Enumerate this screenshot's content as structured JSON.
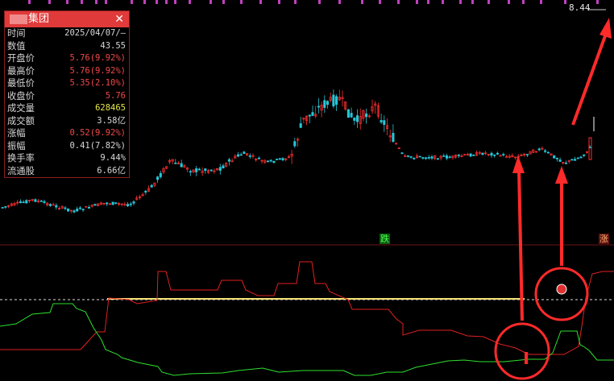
{
  "panel": {
    "title": "集团",
    "close_icon": "close-icon",
    "rows": [
      {
        "label": "时间",
        "value": "2025/04/07/—",
        "color": "#d7d7d7"
      },
      {
        "label": "数值",
        "value": "43.55",
        "color": "#d7d7d7"
      },
      {
        "label": "开盘价",
        "value": "5.76(9.92%)",
        "color": "#f04848"
      },
      {
        "label": "最高价",
        "value": "5.76(9.92%)",
        "color": "#f04848"
      },
      {
        "label": "最低价",
        "value": "5.35(2.10%)",
        "color": "#f04848"
      },
      {
        "label": "收盘价",
        "value": "5.76",
        "color": "#f04848"
      },
      {
        "label": "成交量",
        "value": "628465",
        "color": "#e6e64a"
      },
      {
        "label": "成交额",
        "value": "3.58亿",
        "color": "#d7d7d7"
      },
      {
        "label": "涨幅",
        "value": "0.52(9.92%)",
        "color": "#f04848"
      },
      {
        "label": "振幅",
        "value": "0.41(7.82%)",
        "color": "#d7d7d7"
      },
      {
        "label": "换手率",
        "value": "9.44%",
        "color": "#d7d7d7"
      },
      {
        "label": "流通股",
        "value": "6.66亿",
        "color": "#d7d7d7"
      }
    ]
  },
  "price_top": "8.44",
  "signals": {
    "die": "跌",
    "zhang": "涨"
  },
  "colors": {
    "up": "#ff3030",
    "down": "#26c6d8",
    "bg": "#000000",
    "yellow": "#f5e27a",
    "green": "#2ee02e",
    "annot": "#ff2a2a"
  },
  "annotation_icon": "red-circle-arrow-annotation"
}
